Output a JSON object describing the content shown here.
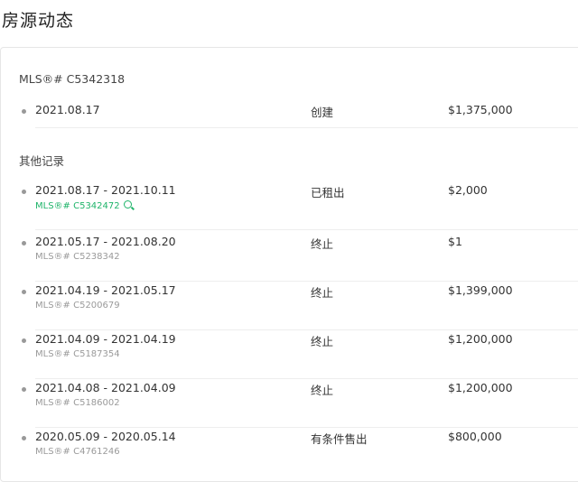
{
  "page": {
    "title": "房源动态"
  },
  "current": {
    "mls_label": "MLS®# C5342318",
    "row": {
      "date": "2021.08.17",
      "status": "创建",
      "price": "$1,375,000"
    }
  },
  "others": {
    "label": "其他记录",
    "rows": [
      {
        "date": "2021.08.17 - 2021.10.11",
        "mls": "MLS®# C5342472",
        "status": "已租出",
        "price": "$2,000"
      },
      {
        "date": "2021.05.17 - 2021.08.20",
        "mls": "MLS®# C5238342",
        "status": "终止",
        "price": "$1"
      },
      {
        "date": "2021.04.19 - 2021.05.17",
        "mls": "MLS®# C5200679",
        "status": "终止",
        "price": "$1,399,000"
      },
      {
        "date": "2021.04.09 - 2021.04.19",
        "mls": "MLS®# C5187354",
        "status": "终止",
        "price": "$1,200,000"
      },
      {
        "date": "2021.04.08 - 2021.04.09",
        "mls": "MLS®# C5186002",
        "status": "终止",
        "price": "$1,200,000"
      },
      {
        "date": "2020.05.09 - 2020.05.14",
        "mls": "MLS®# C4761246",
        "status": "有条件售出",
        "price": "$800,000"
      }
    ]
  },
  "colors": {
    "link_green": "#1fb46a",
    "muted_gray": "#9a9a9a"
  },
  "icons": {
    "active_listing": "search-icon"
  }
}
